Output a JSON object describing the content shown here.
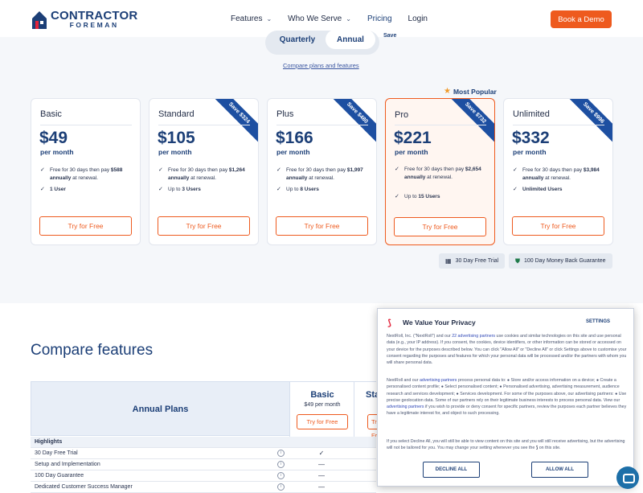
{
  "brand": {
    "name_line1": "CONTRACTOR",
    "name_line2": "FOREMAN",
    "colors": {
      "primary": "#1c3f77",
      "accent": "#ee5a1e",
      "ribbon": "#1d4fa1"
    }
  },
  "nav": {
    "items": [
      {
        "label": "Features",
        "has_dropdown": true
      },
      {
        "label": "Who We Serve",
        "has_dropdown": true
      },
      {
        "label": "Pricing",
        "has_dropdown": false
      },
      {
        "label": "Login",
        "has_dropdown": false
      }
    ],
    "cta": "Book a Demo"
  },
  "billing": {
    "quarterly": "Quarterly",
    "annual": "Annual",
    "selected": "Annual",
    "extra": "Save"
  },
  "compare_link": "Compare plans and features",
  "most_popular": "Most Popular",
  "plans": [
    {
      "name": "Basic",
      "price": "$49",
      "period": "per month",
      "trial_pre": "Free for 30 days then pay ",
      "trial_amount": "$588",
      "trial_bold": " annually",
      "trial_post": " at renewal.",
      "users": "1 User",
      "users_pre": "",
      "cta": "Try for Free",
      "save": ""
    },
    {
      "name": "Standard",
      "price": "$105",
      "period": "per month",
      "trial_pre": "Free for 30 days then pay ",
      "trial_amount": "$1,264",
      "trial_bold": " annually",
      "trial_post": " at renewal.",
      "users_pre": "Up to ",
      "users": "3 Users",
      "cta": "Try for Free",
      "save": "Save $324"
    },
    {
      "name": "Plus",
      "price": "$166",
      "period": "per month",
      "trial_pre": "Free for 30 days then pay ",
      "trial_amount": "$1,997",
      "trial_bold": " annually",
      "trial_post": " at renewal.",
      "users_pre": "Up to ",
      "users": "8 Users",
      "cta": "Try for Free",
      "save": "Save $480"
    },
    {
      "name": "Pro",
      "price": "$221",
      "period": "per month",
      "trial_pre": "Free for 30 days then pay ",
      "trial_amount": "$2,654",
      "trial_bold": " annually",
      "trial_post": " at renewal.",
      "users_pre": "Up to ",
      "users": "15 Users",
      "cta": "Try for Free",
      "save": "Save $732"
    },
    {
      "name": "Unlimited",
      "price": "$332",
      "period": "per month",
      "trial_pre": "Free for 30 days then pay ",
      "trial_amount": "$3,984",
      "trial_bold": " annually",
      "trial_post": " at renewal.",
      "users_pre": "",
      "users": "Unlimited Users",
      "cta": "Try for Free",
      "save": "Save $996"
    }
  ],
  "badges": {
    "trial": "30 Day Free Trial",
    "guarantee": "100 Day Money Back Guarantee"
  },
  "compare": {
    "title": "Compare features",
    "header": "Annual Plans",
    "basic": {
      "name": "Basic",
      "price": "$49 per month",
      "cta": "Try for Free"
    },
    "standard": {
      "name": "Standard",
      "cta": "Try for Free"
    },
    "section": "Highlights",
    "rows": [
      {
        "label": "30 Day Free Trial",
        "basic": "✓"
      },
      {
        "label": "Setup and Implementation",
        "basic": "—"
      },
      {
        "label": "100 Day Guarantee",
        "basic": "—"
      },
      {
        "label": "Dedicated Customer Success Manager",
        "basic": "—"
      }
    ]
  },
  "privacy": {
    "title": "We Value Your Privacy",
    "settings": "SETTINGS",
    "p1_a": "NextRoll, Inc. (\"NextRoll\") and our ",
    "p1_link": "22 advertising partners",
    "p1_b": " use cookies and similar technologies on this site and use personal data (e.g., your IP address). If you consent, the cookies, device identifiers, or other information can be stored or accessed on your device for the purposes described below. You can click \"Allow All\" or \"Decline All\" or click Settings above to customise your consent regarding the purposes and features for which your personal data will be processed and/or the partners with whom you will share personal data.",
    "p2_a": "NextRoll and our ",
    "p2_link": "advertising partners",
    "p2_b": " process personal data to: ● Store and/or access information on a device; ● Create a personalised content profile; ● Select personalised content; ● Personalised advertising, advertising measurement, audience research and services development; ● Services development. For some of the purposes above, our advertising partners: ● Use precise geolocation data. Some of our partners rely on their legitimate business interests to process personal data. View our ",
    "p2_link2": "advertising partners",
    "p2_c": " if you wish to provide or deny consent for specific partners, review the purposes each partner believes they have a legitimate interest for, and object to such processing.",
    "p3": "If you select Decline All, you will still be able to view content on this site and you will still receive advertising, but the advertising will not be tailored for you. You may change your setting whenever you see the",
    "p3_end": "on this site.",
    "decline": "DECLINE ALL",
    "allow": "ALLOW ALL"
  }
}
